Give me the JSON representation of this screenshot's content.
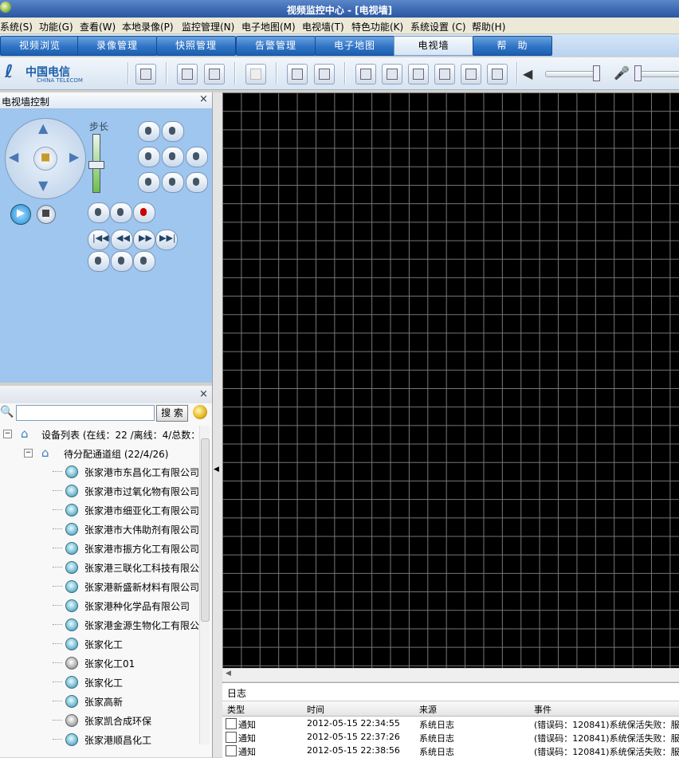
{
  "window": {
    "title": "视频监控中心 - [电视墙]"
  },
  "menu": [
    "系统(S)",
    "功能(G)",
    "查看(W)",
    "本地录像(P)",
    "监控管理(N)",
    "电子地图(M)",
    "电视墙(T)",
    "特色功能(K)",
    "系统设置 (C)",
    "帮助(H)"
  ],
  "tabs": [
    "视频浏览",
    "录像管理",
    "快照管理",
    "告警管理",
    "电子地图",
    "电视墙",
    "帮　助"
  ],
  "active_tab": "电视墙",
  "brand": {
    "name_cn": "中国电信",
    "name_en": "CHINA TELECOM"
  },
  "control_panel": {
    "title": "电视墙控制",
    "step_label": "步长"
  },
  "device_panel": {
    "search_button": "搜 索",
    "search_placeholder": "",
    "root": "设备列表 (在线：22 /离线：4/总数：",
    "group": "待分配通道组 (22/4/26)",
    "devices": [
      {
        "name": "张家港市东昌化工有限公司",
        "online": true
      },
      {
        "name": "张家港市过氧化物有限公司",
        "online": true
      },
      {
        "name": "张家港市细亚化工有限公司",
        "online": true
      },
      {
        "name": "张家港市大伟助剂有限公司",
        "online": true
      },
      {
        "name": "张家港市振方化工有限公司",
        "online": true
      },
      {
        "name": "张家港三联化工科技有限公",
        "online": true
      },
      {
        "name": "张家港新盛新材料有限公司",
        "online": true
      },
      {
        "name": "张家港种化学品有限公司",
        "online": true
      },
      {
        "name": "张家港金源生物化工有限公",
        "online": true
      },
      {
        "name": "张家化工",
        "online": true
      },
      {
        "name": "张家化工01",
        "online": false
      },
      {
        "name": "张家化工",
        "online": true
      },
      {
        "name": "张家高新",
        "online": true
      },
      {
        "name": "张家凯合成环保",
        "online": false
      },
      {
        "name": "张家港顺昌化工",
        "online": true
      }
    ]
  },
  "log": {
    "title": "日志",
    "columns": [
      "类型",
      "时间",
      "来源",
      "事件"
    ],
    "rows": [
      {
        "type": "通知",
        "time": "2012-05-15 22:34:55",
        "source": "系统日志",
        "event": "(错误码：120841)系统保活失败：服"
      },
      {
        "type": "通知",
        "time": "2012-05-15 22:37:26",
        "source": "系统日志",
        "event": "(错误码：120841)系统保活失败：服"
      },
      {
        "type": "通知",
        "time": "2012-05-15 22:38:56",
        "source": "系统日志",
        "event": "(错误码：120841)系统保活失败：服"
      }
    ]
  },
  "colors": {
    "tab_blue": "#2f73c5",
    "panel_blue": "#9ec6ee",
    "video_bg": "#000000",
    "grid": "#777777"
  }
}
